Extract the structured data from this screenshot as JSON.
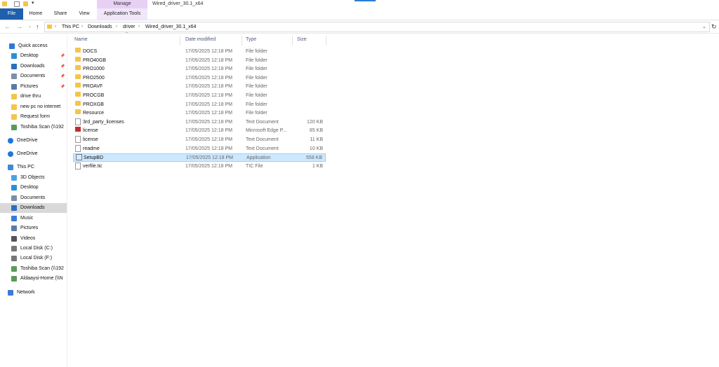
{
  "title_bar": {
    "context_tab": "Manage",
    "window_title": "Wired_driver_30.1_x64",
    "quick_access_icons": [
      "folder-icon",
      "properties-icon",
      "new-folder-icon",
      "customize-arrow-icon"
    ]
  },
  "ribbon": {
    "tabs": [
      "File",
      "Home",
      "Share",
      "View",
      "Application Tools"
    ]
  },
  "address": {
    "crumbs": [
      "This PC",
      "Downloads",
      "driver",
      "Wired_driver_30.1_x64"
    ],
    "nav_icons": [
      "back-arrow-icon",
      "forward-arrow-icon",
      "recent-dropdown-icon",
      "up-arrow-icon"
    ]
  },
  "nav": {
    "items": [
      {
        "label": "Quick access",
        "icon": "star-icon",
        "pinned": false
      },
      {
        "label": "Desktop",
        "icon": "desktop-icon",
        "pinned": true
      },
      {
        "label": "Downloads",
        "icon": "download-icon",
        "pinned": true
      },
      {
        "label": "Documents",
        "icon": "documents-icon",
        "pinned": true
      },
      {
        "label": "Pictures",
        "icon": "pictures-icon",
        "pinned": true
      },
      {
        "label": "drive thru",
        "icon": "folder-icon",
        "pinned": false
      },
      {
        "label": "new pc no internet",
        "icon": "folder-icon",
        "pinned": false
      },
      {
        "label": "Request form",
        "icon": "folder-icon",
        "pinned": false
      },
      {
        "label": "Toshiba Scan (\\\\192",
        "icon": "network-drive-icon",
        "pinned": false
      },
      {
        "label": "OneDrive",
        "icon": "cloud-icon",
        "pinned": false
      },
      {
        "label": "OneDrive",
        "icon": "cloud-icon",
        "pinned": false
      },
      {
        "label": "This PC",
        "icon": "computer-icon",
        "pinned": false
      },
      {
        "label": "3D Objects",
        "icon": "cube-icon",
        "pinned": false
      },
      {
        "label": "Desktop",
        "icon": "desktop-icon",
        "pinned": false
      },
      {
        "label": "Documents",
        "icon": "documents-icon",
        "pinned": false
      },
      {
        "label": "Downloads",
        "icon": "download-icon",
        "pinned": false,
        "selected": true
      },
      {
        "label": "Music",
        "icon": "music-icon",
        "pinned": false
      },
      {
        "label": "Pictures",
        "icon": "pictures-icon",
        "pinned": false
      },
      {
        "label": "Videos",
        "icon": "videos-icon",
        "pinned": false
      },
      {
        "label": "Local Disk (C:)",
        "icon": "disk-icon",
        "pinned": false
      },
      {
        "label": "Local Disk (F:)",
        "icon": "disk-icon",
        "pinned": false
      },
      {
        "label": "Toshiba Scan (\\\\192",
        "icon": "network-drive-icon",
        "pinned": false
      },
      {
        "label": "Aldaaysi-Home (\\\\N",
        "icon": "network-drive-icon",
        "pinned": false
      },
      {
        "label": "Network",
        "icon": "network-icon",
        "pinned": false
      }
    ]
  },
  "columns": {
    "name": "Name",
    "date": "Date modified",
    "type": "Type",
    "size": "Size"
  },
  "files": [
    {
      "name": "DOCS",
      "date": "17/05/2025 12:18 PM",
      "type": "File folder",
      "size": "",
      "icon": "folder"
    },
    {
      "name": "PRO40GB",
      "date": "17/05/2025 12:18 PM",
      "type": "File folder",
      "size": "",
      "icon": "folder"
    },
    {
      "name": "PRO1000",
      "date": "17/05/2025 12:18 PM",
      "type": "File folder",
      "size": "",
      "icon": "folder"
    },
    {
      "name": "PRO2500",
      "date": "17/05/2025 12:18 PM",
      "type": "File folder",
      "size": "",
      "icon": "folder"
    },
    {
      "name": "PROAVF",
      "date": "17/05/2025 12:18 PM",
      "type": "File folder",
      "size": "",
      "icon": "folder"
    },
    {
      "name": "PROCGB",
      "date": "17/05/2025 12:18 PM",
      "type": "File folder",
      "size": "",
      "icon": "folder"
    },
    {
      "name": "PROXGB",
      "date": "17/05/2025 12:18 PM",
      "type": "File folder",
      "size": "",
      "icon": "folder"
    },
    {
      "name": "Resource",
      "date": "17/05/2025 12:18 PM",
      "type": "File folder",
      "size": "",
      "icon": "folder"
    },
    {
      "name": "3rd_party_licenses",
      "date": "17/05/2025 12:18 PM",
      "type": "Text Document",
      "size": "120 KB",
      "icon": "doc"
    },
    {
      "name": "license",
      "date": "17/05/2025 12:18 PM",
      "type": "Microsoft Edge P...",
      "size": "85 KB",
      "icon": "edge"
    },
    {
      "name": "license",
      "date": "17/05/2025 12:18 PM",
      "type": "Text Document",
      "size": "11 KB",
      "icon": "doc"
    },
    {
      "name": "readme",
      "date": "17/05/2025 12:18 PM",
      "type": "Text Document",
      "size": "10 KB",
      "icon": "doc"
    },
    {
      "name": "SetupBD",
      "date": "17/05/2025 12:18 PM",
      "type": "Application",
      "size": "558 KB",
      "icon": "app",
      "selected": true
    },
    {
      "name": "verfile.tic",
      "date": "17/05/2025 12:18 PM",
      "type": "TIC File",
      "size": "1 KB",
      "icon": "doc"
    }
  ],
  "colors": {
    "file_tab": "#1f5fad",
    "context_tab": "#e8d0f5",
    "selection": "#cce8ff",
    "folder": "#f3c54a"
  }
}
